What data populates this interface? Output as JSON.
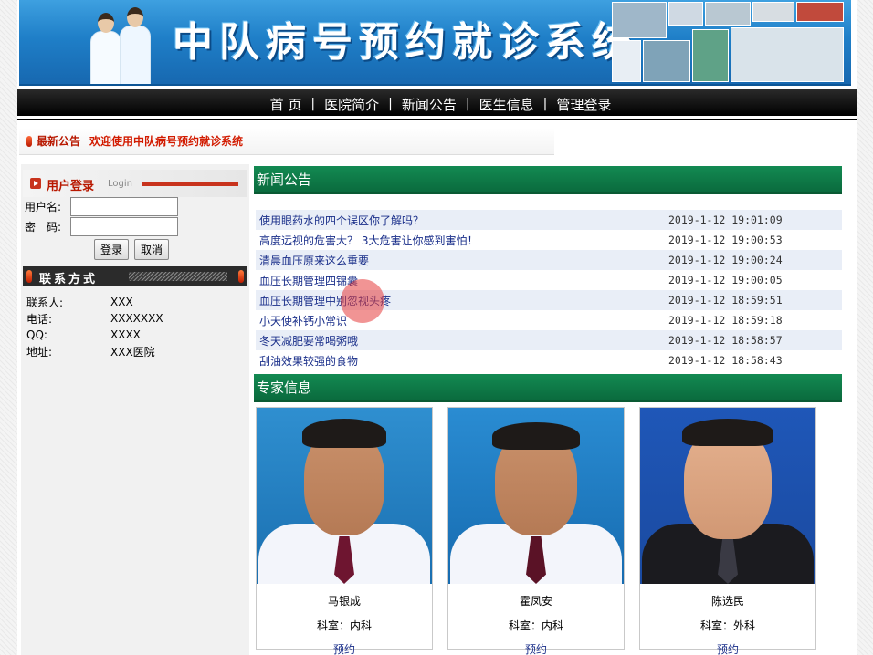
{
  "banner": {
    "title": "中队病号预约就诊系统"
  },
  "nav": {
    "items": [
      "首 页",
      "医院简介",
      "新闻公告",
      "医生信息",
      "管理登录"
    ]
  },
  "notice": {
    "label": "最新公告",
    "text": "欢迎使用中队病号预约就诊系统"
  },
  "login": {
    "title": "用户登录",
    "subtitle": "Login",
    "username_label": "用户名:",
    "password_label": "密　码:",
    "username_value": "",
    "password_value": "",
    "login_button": "登录",
    "cancel_button": "取消"
  },
  "contact": {
    "title": "联系方式",
    "rows": [
      {
        "key": "联系人:",
        "value": "XXX"
      },
      {
        "key": "电话:",
        "value": "XXXXXXX"
      },
      {
        "key": "QQ:",
        "value": "XXXX"
      },
      {
        "key": "地址:",
        "value": "XXX医院"
      }
    ]
  },
  "news": {
    "heading": "新闻公告",
    "items": [
      {
        "title": "使用眼药水的四个误区你了解吗？",
        "date": "2019-1-12 19:01:09"
      },
      {
        "title": "高度远视的危害大？ 3大危害让你感到害怕！",
        "date": "2019-1-12 19:00:53"
      },
      {
        "title": "清晨血压原来这么重要",
        "date": "2019-1-12 19:00:24"
      },
      {
        "title": "血压长期管理四锦囊",
        "date": "2019-1-12 19:00:05"
      },
      {
        "title": "血压长期管理中别忽视头疼",
        "date": "2019-1-12 18:59:51"
      },
      {
        "title": "小天使补钙小常识",
        "date": "2019-1-12 18:59:18"
      },
      {
        "title": "冬天减肥要常喝粥哦",
        "date": "2019-1-12 18:58:57"
      },
      {
        "title": "刮油效果较强的食物",
        "date": "2019-1-12 18:58:43"
      }
    ]
  },
  "experts": {
    "heading": "专家信息",
    "items": [
      {
        "name": "马银成",
        "dept": "科室：内科",
        "book": "预约"
      },
      {
        "name": "霍凤安",
        "dept": "科室：内科",
        "book": "预约"
      },
      {
        "name": "陈选民",
        "dept": "科室：外科",
        "book": "预约"
      }
    ]
  }
}
